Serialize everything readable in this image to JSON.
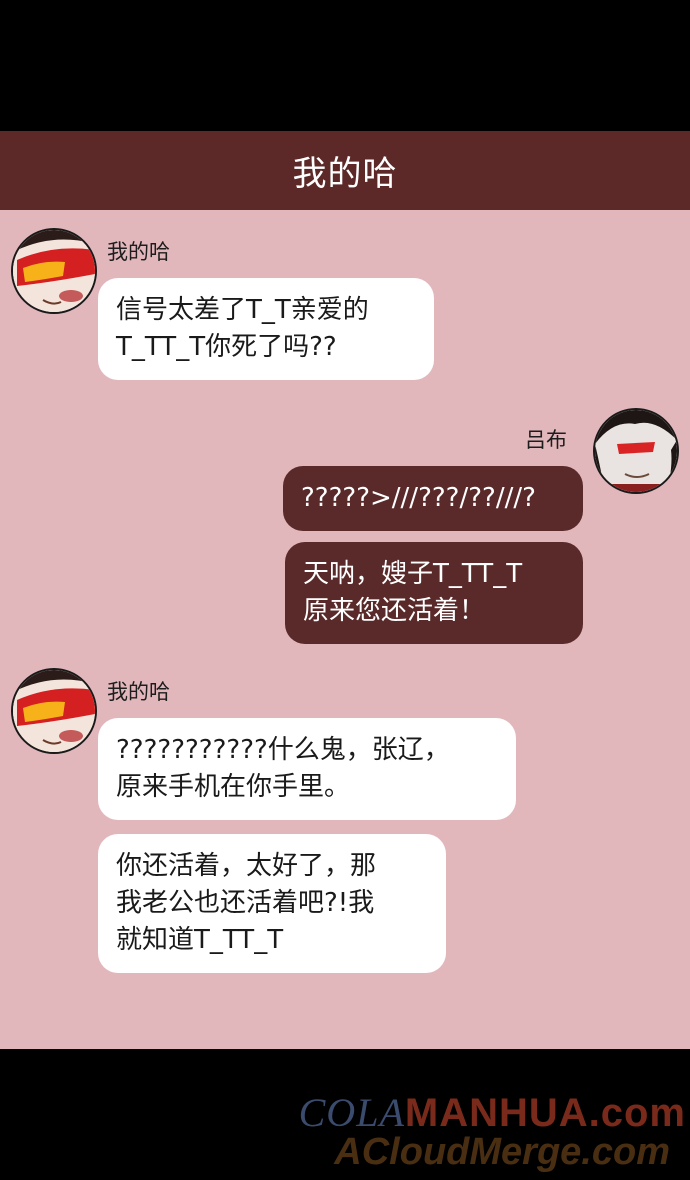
{
  "header": {
    "title": "我的哈"
  },
  "messages": [
    {
      "sender": "我的哈",
      "side": "left",
      "avatar_icon": "woman-red-goggles-avatar",
      "bubbles": [
        "信号太差了T_T亲爱的\nT_TT_T你死了吗??"
      ]
    },
    {
      "sender": "吕布",
      "side": "right",
      "avatar_icon": "man-red-sunglasses-avatar",
      "bubbles": [
        "?????>///???/??///?",
        "天呐，嫂子T_TT_T\n原来您还活着！"
      ]
    },
    {
      "sender": "我的哈",
      "side": "left",
      "avatar_icon": "woman-red-goggles-avatar",
      "bubbles": [
        "???????????什么鬼，张辽，\n原来手机在你手里。",
        "你还活着，太好了，那\n我老公也还活着吧?!我\n就知道T_TT_T"
      ]
    }
  ],
  "watermark": {
    "line1_a": "COLA",
    "line1_b": "MANHUA.com",
    "line2": "ACloudMerge.com"
  },
  "colors": {
    "header_bg": "#5c2828",
    "chat_bg": "#e2b7bc",
    "out_bubble": "#5a2a2a",
    "in_bubble": "#ffffff"
  }
}
